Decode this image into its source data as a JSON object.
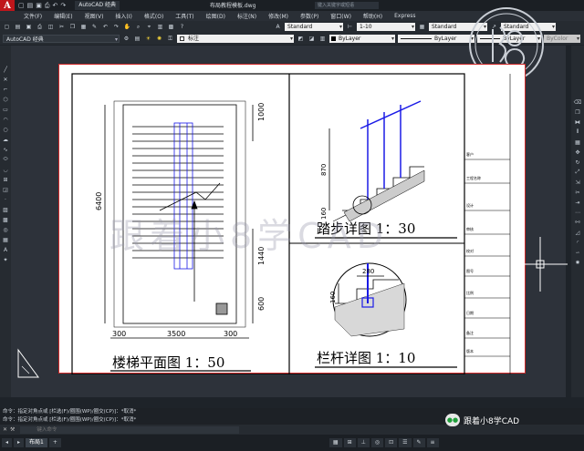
{
  "app": {
    "logo_letter": "A",
    "workspace": "AutoCAD 经典",
    "document_title": "布局教程模板.dwg",
    "search_placeholder": "键入关键字或短语"
  },
  "menu": [
    "文件(F)",
    "编辑(E)",
    "视图(V)",
    "插入(I)",
    "格式(O)",
    "工具(T)",
    "绘图(D)",
    "标注(N)",
    "修改(M)",
    "参数(P)",
    "窗口(W)",
    "帮助(H)",
    "Express"
  ],
  "toolbar": {
    "workspace_dropdown": "AutoCAD 经典",
    "text_style": "Standard",
    "dim_scale": "1-10",
    "table_style": "Standard",
    "multileader_style": "Standard",
    "layer": "标注",
    "color": "ByLayer",
    "linetype": "ByLayer",
    "lineweight": "ByLayer",
    "plotstyle": "ByColor"
  },
  "drawing": {
    "stair_plan_title": "楼梯平面图 1：50",
    "step_detail_title": "踏步详图 1：30",
    "rail_detail_title": "栏杆详图 1：10",
    "dims": {
      "total_length": "6400",
      "top_seg": "1000",
      "lower_seg": "1440",
      "bottom_seg": "600",
      "width": "3500",
      "left_wall": "300",
      "right_wall": "300",
      "step_height": "870",
      "step_base": "160",
      "rail_width": "280",
      "rail_height": "160"
    },
    "title_block_labels": [
      "客户",
      "工程名称",
      "设计",
      "审核",
      "校对",
      "图号",
      "比例",
      "日期",
      "备注",
      "版本"
    ]
  },
  "watermark": "跟着小8学CAD",
  "command": {
    "history_1": "命令：指定对角点或 [栏选(F)/圈围(WP)/圈交(CP)]：*取消*",
    "history_2": "命令：指定对角点或 [栏选(F)/圈围(WP)/圈交(CP)]：*取消*",
    "input_placeholder": "键入命令"
  },
  "layout_tabs": [
    "布局1"
  ],
  "wechat_label": "跟着小8学CAD",
  "colors": {
    "sheet_border": "#cf2a2a",
    "cad_blue": "#1a1ae6",
    "canvas": "#2d323a"
  }
}
